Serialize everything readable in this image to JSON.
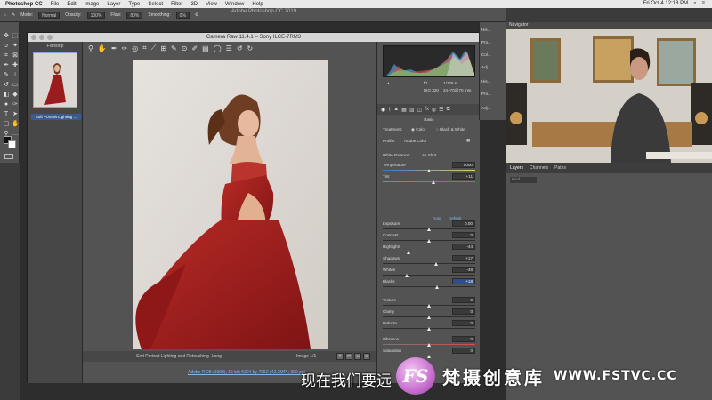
{
  "menubar": {
    "app": "Photoshop CC",
    "items": [
      "File",
      "Edit",
      "Image",
      "Layer",
      "Type",
      "Select",
      "Filter",
      "3D",
      "View",
      "Window",
      "Help"
    ],
    "clock": "Fri Oct 4 12:18 PM"
  },
  "options_bar": {
    "mode_label": "Mode:",
    "mode_value": "Normal",
    "opacity_label": "Opacity:",
    "opacity_value": "100%",
    "flow_label": "Flow:",
    "flow_value": "80%",
    "smoothing_label": "Smoothing:",
    "smoothing_value": "0%"
  },
  "ps_title": "Adobe Photoshop CC 2019",
  "camera_raw": {
    "title": "Camera Raw 11.4.1  –  Sony ILCE-7RM3",
    "filmstrip_label": "Filmstrip",
    "thumb_caption": "Soft Portrait Lighting ...",
    "footer_name": "Soft Portrait Lighting and Retouching -Long",
    "footer_image": "Image 1/1",
    "workflow_link": "Adobe RGB (1998); 16 bit; 5304 by 7952 (42.2MP); 300 ppi",
    "meta": {
      "aperture": "f/1",
      "shutter": "1/125 s",
      "iso": "ISO 320",
      "lens": "24–70@70 mm"
    },
    "panel_title": "Basic",
    "treatment_label": "Treatment:",
    "treatment_color": "Color",
    "treatment_bw": "Black & White",
    "profile_label": "Profile:",
    "profile_value": "Adobe Color",
    "wb_label": "White Balance:",
    "wb_value": "As Shot",
    "auto": "Auto",
    "default": "Default",
    "sliders": [
      {
        "label": "Temperature",
        "value": "5000",
        "pos": 0.5
      },
      {
        "label": "Tint",
        "value": "+11",
        "pos": 0.55
      },
      {
        "label": "Exposure",
        "value": "0.00",
        "pos": 0.5
      },
      {
        "label": "Contrast",
        "value": "0",
        "pos": 0.5
      },
      {
        "label": "Highlights",
        "value": "-44",
        "pos": 0.28
      },
      {
        "label": "Shadows",
        "value": "+17",
        "pos": 0.58
      },
      {
        "label": "Whites",
        "value": "-48",
        "pos": 0.26
      },
      {
        "label": "Blacks",
        "value": "+18",
        "pos": 0.59
      },
      {
        "label": "Texture",
        "value": "0",
        "pos": 0.5
      },
      {
        "label": "Clarity",
        "value": "0",
        "pos": 0.5
      },
      {
        "label": "Dehaze",
        "value": "0",
        "pos": 0.5
      },
      {
        "label": "Vibrance",
        "value": "0",
        "pos": 0.5
      },
      {
        "label": "Saturation",
        "value": "0",
        "pos": 0.5
      }
    ]
  },
  "right_strip": [
    "His...",
    "Pro...",
    "Col...",
    "Adj...",
    "His...",
    "Pro...",
    "Adj..."
  ],
  "navigator_tab": "Navigator",
  "layers": {
    "tabs": [
      "Layers",
      "Channels",
      "Paths"
    ],
    "kind": "Kind"
  },
  "subtitle": "现在我们要远",
  "watermark": {
    "logo": "FS",
    "name": "梵摄创意库",
    "url": "WWW.FSTVC.CC"
  },
  "colors": {
    "accent": "#3b5b8f",
    "dress": "#9b1c1c",
    "panel": "#535353"
  }
}
